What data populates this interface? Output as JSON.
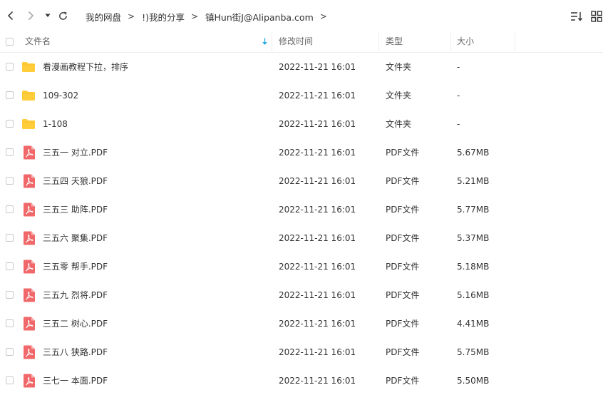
{
  "toolbar": {
    "breadcrumb": [
      {
        "label": "我的网盘"
      },
      {
        "label": "!)我的分享"
      },
      {
        "label": "镇Hun街J@Alipanba.com"
      }
    ],
    "separator": ">"
  },
  "columns": {
    "name": "文件名",
    "modified": "修改时间",
    "type": "类型",
    "size": "大小"
  },
  "files": [
    {
      "name": "看漫画教程下拉，排序",
      "modified": "2022-11-21 16:01",
      "type": "文件夹",
      "size": "-",
      "icon": "folder-icon"
    },
    {
      "name": "109-302",
      "modified": "2022-11-21 16:01",
      "type": "文件夹",
      "size": "-",
      "icon": "folder-icon"
    },
    {
      "name": "1-108",
      "modified": "2022-11-21 16:01",
      "type": "文件夹",
      "size": "-",
      "icon": "folder-icon"
    },
    {
      "name": "三五一 对立.PDF",
      "modified": "2022-11-21 16:01",
      "type": "PDF文件",
      "size": "5.67MB",
      "icon": "pdf-icon"
    },
    {
      "name": "三五四 天狼.PDF",
      "modified": "2022-11-21 16:01",
      "type": "PDF文件",
      "size": "5.21MB",
      "icon": "pdf-icon"
    },
    {
      "name": "三五三 助阵.PDF",
      "modified": "2022-11-21 16:01",
      "type": "PDF文件",
      "size": "5.77MB",
      "icon": "pdf-icon"
    },
    {
      "name": "三五六 聚集.PDF",
      "modified": "2022-11-21 16:01",
      "type": "PDF文件",
      "size": "5.37MB",
      "icon": "pdf-icon"
    },
    {
      "name": "三五零 帮手.PDF",
      "modified": "2022-11-21 16:01",
      "type": "PDF文件",
      "size": "5.18MB",
      "icon": "pdf-icon"
    },
    {
      "name": "三五九 烈将.PDF",
      "modified": "2022-11-21 16:01",
      "type": "PDF文件",
      "size": "5.16MB",
      "icon": "pdf-icon"
    },
    {
      "name": "三五二 树心.PDF",
      "modified": "2022-11-21 16:01",
      "type": "PDF文件",
      "size": "4.41MB",
      "icon": "pdf-icon"
    },
    {
      "name": "三五八 狭路.PDF",
      "modified": "2022-11-21 16:01",
      "type": "PDF文件",
      "size": "5.75MB",
      "icon": "pdf-icon"
    },
    {
      "name": "三七一 本面.PDF",
      "modified": "2022-11-21 16:01",
      "type": "PDF文件",
      "size": "5.50MB",
      "icon": "pdf-icon"
    }
  ],
  "colors": {
    "folder": "#FFCD3A",
    "pdf": "#F0686A",
    "sort_arrow": "#2AA9E0"
  }
}
